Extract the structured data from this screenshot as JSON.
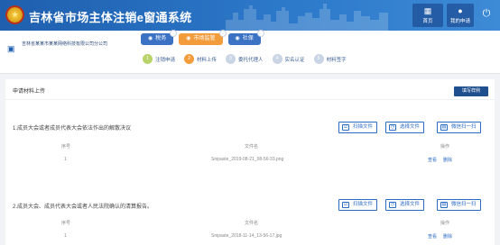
{
  "header": {
    "title": "吉林省市场主体注销e窗通系统",
    "home_label": "首页",
    "mine_label": "我的申请",
    "home_icon": "home-icon",
    "mine_icon": "user-icon",
    "power_icon": "power-icon",
    "emblem_icon": "national-emblem-icon"
  },
  "company": {
    "name": "吉林省某某市某某网络科技有限公司分公司"
  },
  "tabs": [
    {
      "label": "税务",
      "badge": "…",
      "active": false
    },
    {
      "label": "市场监管",
      "badge": "…",
      "active": true
    },
    {
      "label": "社保",
      "badge": "…",
      "active": false
    }
  ],
  "steps": [
    {
      "num": "1",
      "label": "注销申请",
      "state": "done"
    },
    {
      "num": "2",
      "label": "材料上传",
      "state": "current"
    },
    {
      "num": "3",
      "label": "委托代理人",
      "state": "todo"
    },
    {
      "num": "4",
      "label": "实名认证",
      "state": "todo"
    },
    {
      "num": "5",
      "label": "材料签字",
      "state": "todo"
    }
  ],
  "main": {
    "title": "申请材料上传",
    "template_button": "填写样例",
    "columns": {
      "index": "序号",
      "filename": "文件名",
      "op": "操作"
    },
    "actions": {
      "scan": "扫描文件",
      "choose": "选择文件",
      "wechat": "微信扫一扫"
    },
    "sections": [
      {
        "question": "1.成员大会或者成员代表大会依法作出的解散决议",
        "rows": [
          {
            "index": "1",
            "filename": "Snipaste_2019-08-21_08-56-33.png",
            "view": "查看",
            "delete": "删除"
          }
        ]
      },
      {
        "question": "2.成员大会、成员代表大会或者人民法院确认的清算报告。",
        "rows": [
          {
            "index": "1",
            "filename": "Snipaste_2018-11-14_13-56-17.jpg",
            "view": "查看",
            "delete": "删除"
          }
        ]
      }
    ]
  },
  "colors": {
    "header_blue": "#1f5fae",
    "accent_orange": "#f39c3c",
    "link_blue": "#2b6cc4",
    "step_done_green": "#b7d36a"
  }
}
